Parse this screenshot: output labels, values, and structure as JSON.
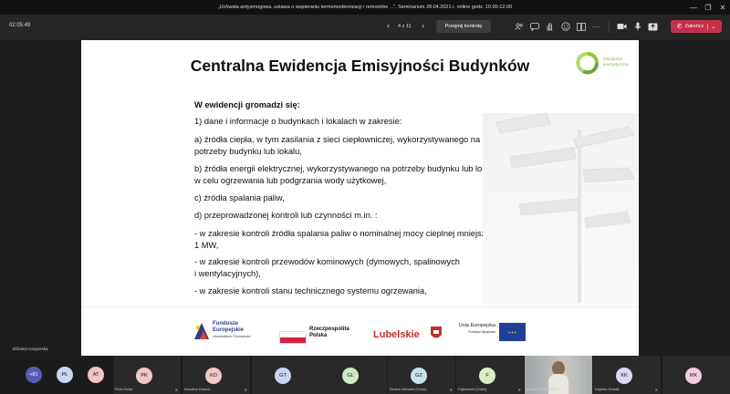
{
  "window": {
    "title": "„Uchwała antysmogowa, ustawa o wspieraniu termomodernizacji i remontów ...\". Seminarium 28.04.2021 r. online godz. 10.00-12.00",
    "controls": [
      "—",
      "❐",
      "✕"
    ]
  },
  "toolbar": {
    "timer": "02:05:49",
    "page_indicator": "4 z 11",
    "take_control_label": "Przejmij kontrolę",
    "leave_label": "Zakończ",
    "icons": [
      "people-icon",
      "chat-icon",
      "hand-raise-icon",
      "reactions-icon",
      "rooms-icon",
      "more-icon",
      "camera-icon",
      "mic-icon",
      "share-icon"
    ]
  },
  "slide": {
    "title": "Centralna Ewidencja Emisyjności Budynków",
    "logo_text": "Świadoma energetycznie",
    "heading": "W ewidencji gromadzi się:",
    "lines": [
      "1) dane i informacje o budynkach i lokalach w zakresie:",
      "a) źródła ciepła, w tym zasilania z sieci ciepłowniczej, wykorzystywanego na",
      "potrzeby budynku lub lokalu,",
      "b) źródła energii elektrycznej, wykorzystywanego na potrzeby budynku lub lokalu",
      "w celu ogrzewania lub podgrzania wody użytkowej,",
      "c) źródła spalania paliw,",
      "d) przeprowadzonej kontroli lub czynności m.in. :",
      "- w zakresie kontroli źródła spalania paliw o nominalnej mocy cieplnej mniejszej niż",
      "1 MW,",
      "- w zakresie kontroli przewodów kominowych (dymowych, spalinowych",
      "i wentylacyjnych),",
      "- w zakresie kontroli stanu technicznego systemu ogrzewania,"
    ],
    "footer_logos": {
      "eu_funds": [
        "Fundusze",
        "Europejskie",
        "Infrastruktura i Środowisko"
      ],
      "rp": [
        "Rzeczpospolita",
        "Polska"
      ],
      "lubelskie": "Lubelskie",
      "ue": [
        "Unia Europejska",
        "Fundusz Spójności"
      ]
    }
  },
  "presenter_label": "Elżbieta Kacperska",
  "participants": {
    "overflow": "+81",
    "small_avatars": [
      {
        "initials": "PŁ",
        "color": "#c9d6f0"
      },
      {
        "initials": "AT",
        "color": "#f0c4c4"
      }
    ],
    "tiles": [
      {
        "initials": "PK",
        "name": "Piotr Kicka",
        "color": "#f3c6c6"
      },
      {
        "initials": "KD",
        "name": "Karolina Dmuch",
        "color": "#f0c8c8"
      },
      {
        "initials": "GT",
        "name": "",
        "color": "#c8d4ef"
      },
      {
        "initials": "GL",
        "name": "",
        "color": "#cfe8c8"
      },
      {
        "initials": "GZ",
        "name": "Gmina Zamość (Gość)",
        "color": "#c8e3ea"
      },
      {
        "initials": "F",
        "name": "Fajdowice (Gość)",
        "color": "#d8ecc8"
      },
      {
        "initials": "",
        "name": "Elżbieta Kacperska",
        "color": ""
      },
      {
        "initials": "KK",
        "name": "Kajetan Kościk",
        "color": "#dcd6ee"
      },
      {
        "initials": "MK",
        "name": "",
        "color": "#f0cde0"
      }
    ]
  }
}
